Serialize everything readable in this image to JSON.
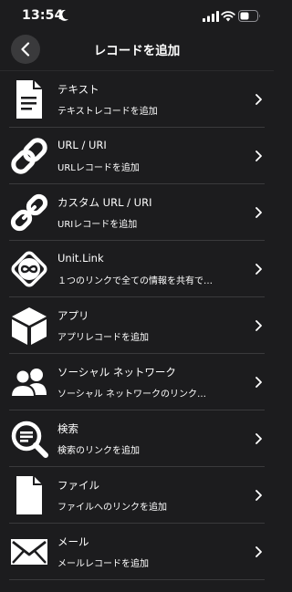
{
  "status_bar": {
    "time": "13:54",
    "icons": [
      "moon-icon",
      "signal-icon",
      "wifi-icon",
      "battery-icon"
    ]
  },
  "nav": {
    "title": "レコードを追加",
    "back_icon": "chevron-left-icon"
  },
  "items": [
    {
      "title": "テキスト",
      "subtitle": "テキストレコードを追加",
      "icon": "document-text-icon"
    },
    {
      "title": "URL / URI",
      "subtitle": "URLレコードを追加",
      "icon": "link-icon"
    },
    {
      "title": "カスタム URL / URI",
      "subtitle": "URIレコードを追加",
      "icon": "broken-link-icon"
    },
    {
      "title": "Unit.Link",
      "subtitle": "１つのリンクで全ての情報を共有で…",
      "icon": "infinity-icon"
    },
    {
      "title": "アプリ",
      "subtitle": "アプリレコードを追加",
      "icon": "cube-icon"
    },
    {
      "title": "ソーシャル ネットワーク",
      "subtitle": "ソーシャル ネットワークのリンク…",
      "icon": "people-icon"
    },
    {
      "title": "検索",
      "subtitle": "検索のリンクを追加",
      "icon": "search-icon"
    },
    {
      "title": "ファイル",
      "subtitle": "ファイルへのリンクを追加",
      "icon": "file-icon"
    },
    {
      "title": "メール",
      "subtitle": "メールレコードを追加",
      "icon": "mail-icon"
    }
  ],
  "colors": {
    "background": "#1c1c1e",
    "separator": "#3a3a3c",
    "back_button": "#3a3a3c",
    "text": "#ffffff"
  }
}
